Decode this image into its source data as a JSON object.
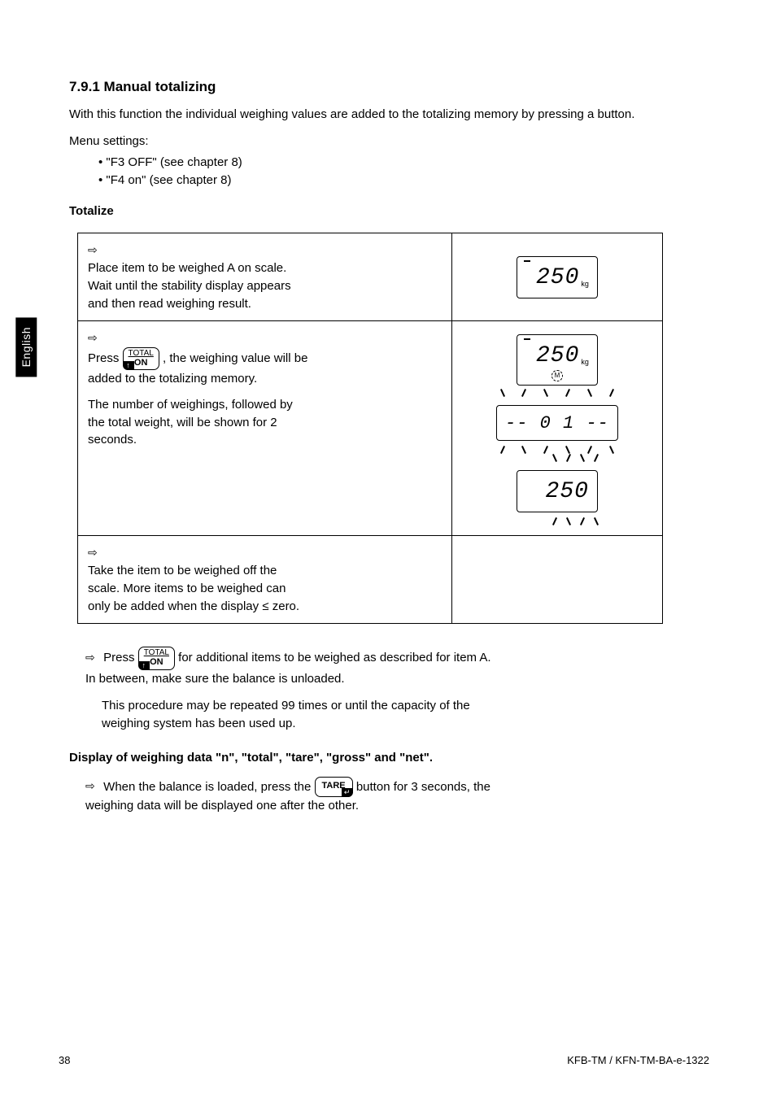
{
  "side_tab": "English",
  "section1": {
    "num": "7.9.1",
    "title": "Manual totalizing"
  },
  "intro": "With this function the individual weighing values are added to the totalizing memory by pressing a button.",
  "setting": "Menu settings:",
  "settings_list": [
    "\"F3 OFF\" (see chapter 8)",
    "\"F4 on\" (see chapter 8)"
  ],
  "totalize_h": "Totalize",
  "steps": {
    "s1_text": "Place item to be weighed A on scale.\nWait until the stability display appears\nand then read weighing result.",
    "s2_text_a": "Press ",
    "s2_text_b": ", the weighing value will be\nadded to the totalizing memory.",
    "s2_text_c": "The number of weighings, followed by\nthe total weight, will be shown for 2\nseconds.",
    "s3_text": "Take the item to be weighed off the\nscale. More items to be weighed can\nonly be added when the display ≤ zero."
  },
  "keys": {
    "total_on_top": "TOTAL",
    "total_on_bot": "ON",
    "total_on_sym": "↑",
    "tare_label": "TARE",
    "tare_sym": "↵"
  },
  "lcd": {
    "v1": "250",
    "unit": "kg",
    "m": "M",
    "count": "-- 0 1 --",
    "v2": "250"
  },
  "post_step1": {
    "a": "Press ",
    "b": " for additional items to be weighed as described for item A.\nIn between, make sure the balance is unloaded."
  },
  "post_step1_note": "This procedure may be repeated 99 times or until the capacity of the\nweighing system has been used up.",
  "sub_h": "Display of weighing data \"n\", \"total\", \"tare\", \"gross\" and \"net\".",
  "post_step2": {
    "a": "When the balance is loaded, press the ",
    "b": " button for 3 seconds, the\nweighing data will be displayed one after the other."
  },
  "footer_left": "38",
  "footer_right": "KFB-TM / KFN-TM-BA-e-1322"
}
